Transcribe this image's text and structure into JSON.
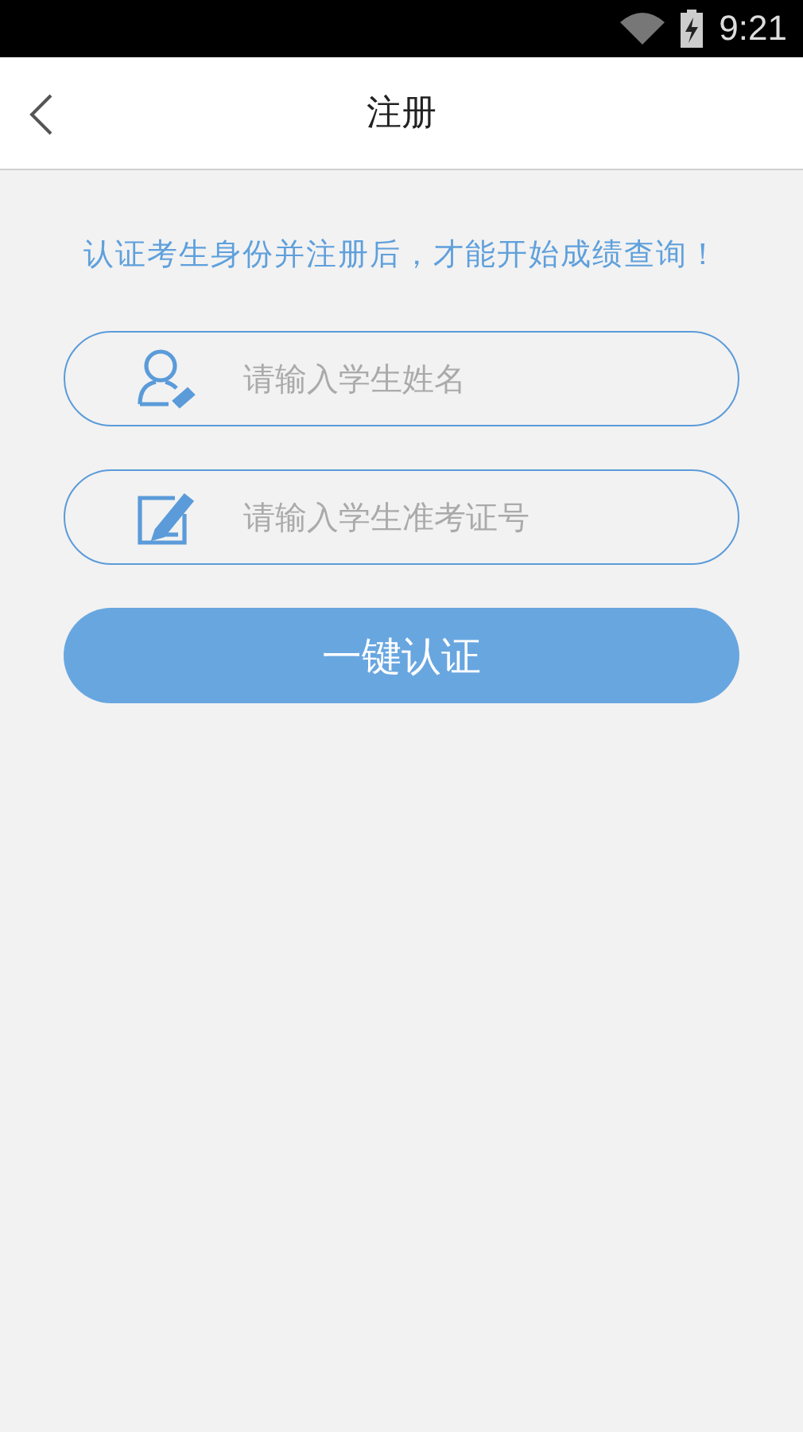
{
  "status_bar": {
    "time": "9:21"
  },
  "header": {
    "title": "注册"
  },
  "notice": "认证考生身份并注册后，才能开始成绩查询！",
  "fields": [
    {
      "kind": "person",
      "placeholder": "请输入学生姓名"
    },
    {
      "kind": "edit",
      "placeholder": "请输入学生准考证号"
    }
  ],
  "submit_button": "一键认证"
}
